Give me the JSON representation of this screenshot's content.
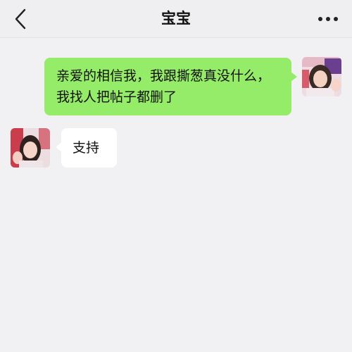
{
  "header": {
    "title": "宝宝",
    "back_icon": "chevron-left-icon",
    "more_icon": "more-horizontal-icon"
  },
  "messages": [
    {
      "direction": "outgoing",
      "text": "亲爱的相信我，我跟撕葱真没什么，我找人把帖子都删了",
      "bubble_color": "#95ec69"
    },
    {
      "direction": "incoming",
      "text": "支持",
      "bubble_color": "#ffffff"
    }
  ],
  "colors": {
    "background": "#f1f0f3",
    "outgoing_bubble": "#95ec69",
    "incoming_bubble": "#ffffff"
  }
}
